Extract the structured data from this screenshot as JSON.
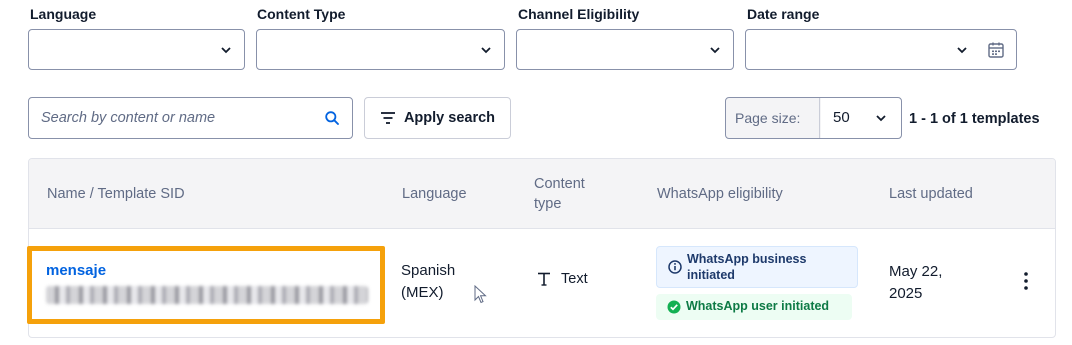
{
  "filters": {
    "language_label": "Language",
    "content_type_label": "Content Type",
    "channel_label": "Channel Eligibility",
    "date_label": "Date range"
  },
  "search": {
    "placeholder": "Search by content or name",
    "apply_label": "Apply search"
  },
  "pagination": {
    "page_size_label": "Page size:",
    "page_size_value": "50",
    "count_text": "1 - 1 of 1 templates"
  },
  "table": {
    "headers": {
      "name": "Name / Template SID",
      "language": "Language",
      "content_type_line1": "Content",
      "content_type_line2": "type",
      "whatsapp": "WhatsApp eligibility",
      "updated": "Last updated"
    },
    "rows": [
      {
        "name": "mensaje",
        "language_line1": "Spanish",
        "language_line2": "(MEX)",
        "content_type": "Text",
        "wa_business": "WhatsApp business initiated",
        "wa_user": "WhatsApp user initiated",
        "updated_line1": "May 22,",
        "updated_line2": "2025"
      }
    ]
  },
  "colors": {
    "link": "#0263e0",
    "highlight": "#f5a10b",
    "success": "#14b053",
    "info": "#1e3a6b"
  }
}
